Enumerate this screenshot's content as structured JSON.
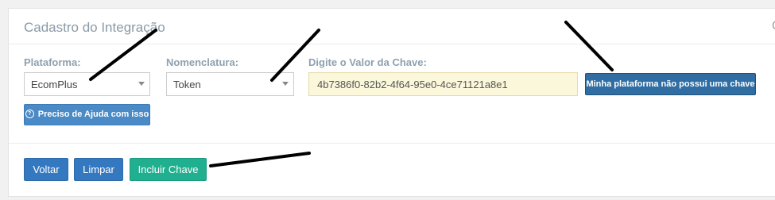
{
  "panel": {
    "title": "Cadastro do Integração"
  },
  "form": {
    "platform_label": "Plataforma:",
    "platform_value": "EcomPlus",
    "naming_label": "Nomenclatura:",
    "naming_value": "Token",
    "key_label": "Digite o Valor da Chave:",
    "key_value": "4b7386f0-82b2-4f64-95e0-4ce71121a8e1"
  },
  "buttons": {
    "no_key": "Minha plataforma não possui uma chave",
    "help": "Preciso de Ajuda com isso",
    "back": "Voltar",
    "clear": "Limpar",
    "include_key": "Incluir Chave"
  },
  "colors": {
    "primary": "#3478c0",
    "primary_dark": "#2f6da2",
    "success": "#20b08f",
    "input_highlight": "#faf7da",
    "label": "#8fa1ae"
  },
  "icons": {
    "help": "question-circle-icon",
    "close": "close-icon",
    "dropdown": "caret-down-icon"
  }
}
